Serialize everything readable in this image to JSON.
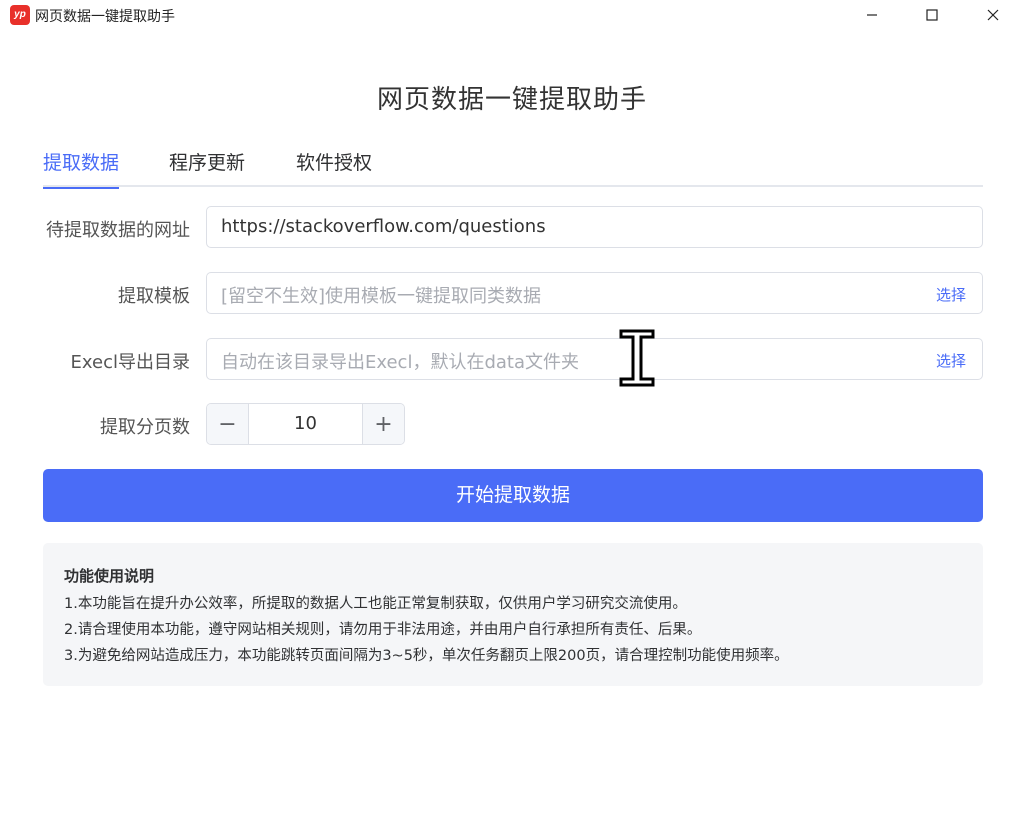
{
  "window": {
    "logo_text": "yp",
    "title": "网页数据一键提取助手"
  },
  "page_title": "网页数据一键提取助手",
  "tabs": [
    {
      "label": "提取数据",
      "active": true
    },
    {
      "label": "程序更新",
      "active": false
    },
    {
      "label": "软件授权",
      "active": false
    }
  ],
  "form": {
    "url": {
      "label": "待提取数据的网址",
      "value": "https://stackoverflow.com/questions"
    },
    "template": {
      "label": "提取模板",
      "placeholder": "[留空不生效]使用模板一键提取同类数据",
      "select_label": "选择"
    },
    "export_dir": {
      "label": "Execl导出目录",
      "placeholder": "自动在该目录导出Execl，默认在data文件夹",
      "select_label": "选择"
    },
    "pages": {
      "label": "提取分页数",
      "value": "10",
      "minus": "−",
      "plus": "+"
    }
  },
  "start_button": "开始提取数据",
  "info": {
    "title": "功能使用说明",
    "lines": [
      "1.本功能旨在提升办公效率，所提取的数据人工也能正常复制获取，仅供用户学习研究交流使用。",
      "2.请合理使用本功能，遵守网站相关规则，请勿用于非法用途，并由用户自行承担所有责任、后果。",
      "3.为避免给网站造成压力，本功能跳转页面间隔为3~5秒，单次任务翻页上限200页，请合理控制功能使用频率。"
    ]
  },
  "colors": {
    "accent": "#4a6cf7",
    "logo": "#e8302a"
  },
  "icons": {
    "minimize": "minimize-icon",
    "maximize": "maximize-icon",
    "close": "close-icon",
    "cursor": "text-cursor-icon"
  }
}
